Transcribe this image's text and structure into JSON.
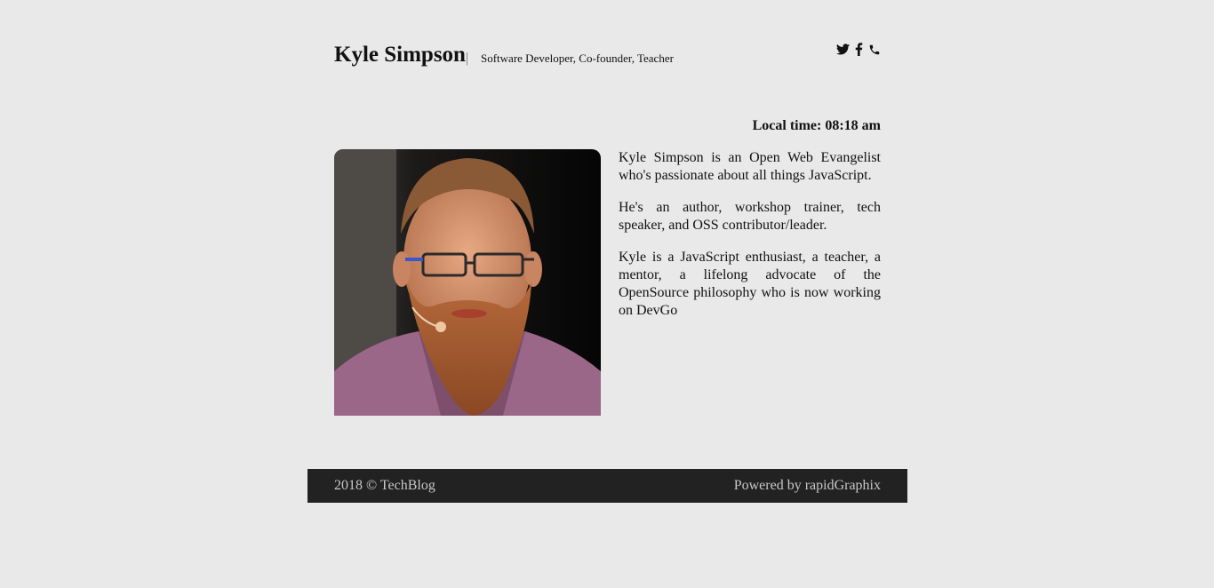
{
  "header": {
    "name": "Kyle Simpson",
    "divider": "|",
    "tagline": "Software Developer, Co-founder, Teacher",
    "social_icons": [
      "twitter-icon",
      "facebook-icon",
      "phone-icon"
    ]
  },
  "local_time": "Local time: 08:18 am",
  "bio": {
    "paragraphs": [
      "Kyle Simpson is an Open Web Evangelist who's passionate about all things JavaScript.",
      "He's an author, workshop trainer, tech speaker, and OSS contributor/leader.",
      "Kyle is a JavaScript enthusiast, a teacher, a mentor, a lifelong advocate of the OpenSource philosophy who is now working on DevGo"
    ]
  },
  "footer": {
    "copyright": "2018 © TechBlog",
    "powered_by": "Powered by rapidGraphix"
  },
  "colors": {
    "background": "#e9e9e9",
    "footer_bg": "#232222",
    "footer_text": "#c8c8c8"
  }
}
